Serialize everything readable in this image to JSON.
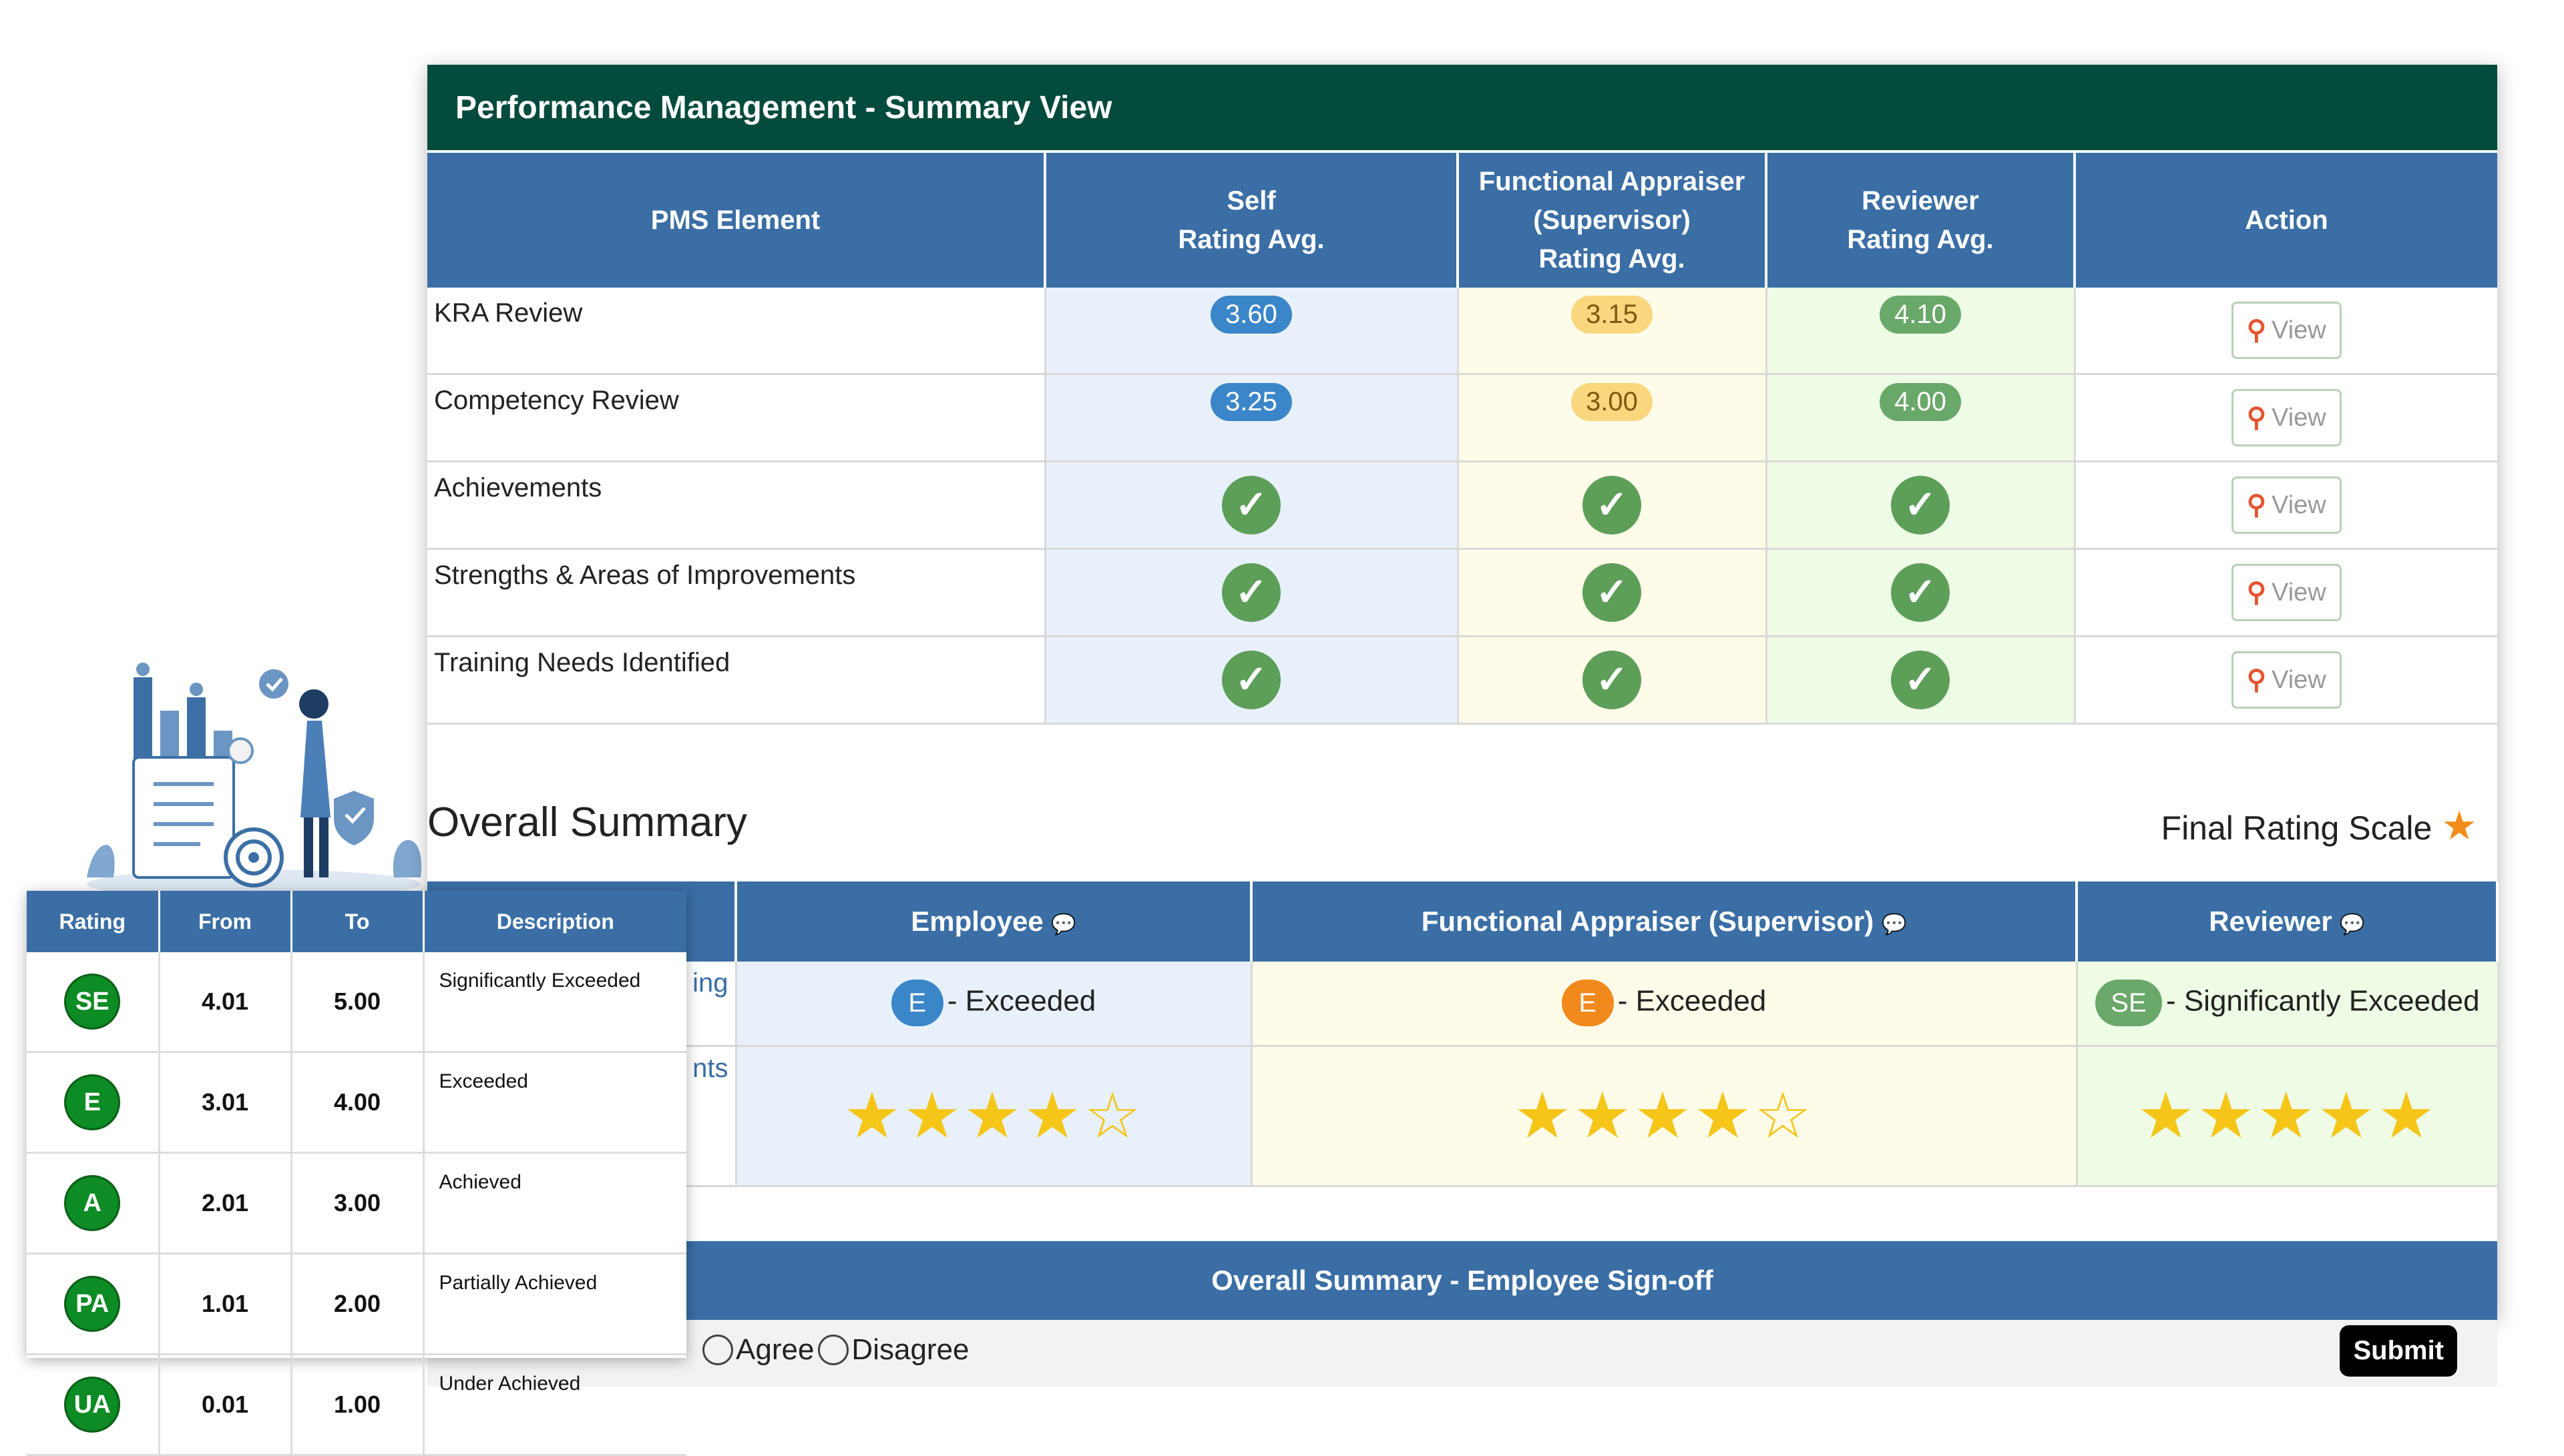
{
  "header": {
    "title": "Performance Management - Summary View"
  },
  "pms_table": {
    "columns": [
      "PMS Element",
      "Self\nRating Avg.",
      "Functional Appraiser\n(Supervisor)\nRating Avg.",
      "Reviewer\nRating Avg.",
      "Action"
    ],
    "rows": [
      {
        "name": "KRA Review",
        "self": "3.60",
        "functional": "3.15",
        "reviewer": "4.10",
        "action": "View"
      },
      {
        "name": "Competency Review",
        "self": "3.25",
        "functional": "3.00",
        "reviewer": "4.00",
        "action": "View"
      },
      {
        "name": "Achievements",
        "self": "check",
        "functional": "check",
        "reviewer": "check",
        "action": "View"
      },
      {
        "name": "Strengths & Areas of Improvements",
        "self": "check",
        "functional": "check",
        "reviewer": "check",
        "action": "View"
      },
      {
        "name": "Training Needs Identified",
        "self": "check",
        "functional": "check",
        "reviewer": "check",
        "action": "View"
      }
    ]
  },
  "overall": {
    "title": "Overall Summary",
    "scale_link": "Final Rating Scale",
    "columns": [
      "",
      "Employee",
      "Functional Appraiser (Supervisor)",
      "Reviewer"
    ],
    "row_labels": [
      "ing",
      "nts"
    ],
    "grades": [
      {
        "code": "E",
        "text": "- Exceeded",
        "color": "#3b86c9"
      },
      {
        "code": "E",
        "text": "- Exceeded",
        "color": "#f2891c"
      },
      {
        "code": "SE",
        "text": "- Significantly Exceeded",
        "color": "#6aa86a"
      }
    ],
    "star_ratings": [
      4,
      4,
      5
    ],
    "star_max": 5
  },
  "signoff": {
    "title": "Overall Summary - Employee Sign-off",
    "agree": "Agree",
    "disagree": "Disagree",
    "submit": "Submit"
  },
  "legend": {
    "columns": [
      "Rating",
      "From",
      "To",
      "Description"
    ],
    "rows": [
      {
        "code": "SE",
        "from": "4.01",
        "to": "5.00",
        "desc": "Significantly Exceeded"
      },
      {
        "code": "E",
        "from": "3.01",
        "to": "4.00",
        "desc": "Exceeded"
      },
      {
        "code": "A",
        "from": "2.01",
        "to": "3.00",
        "desc": "Achieved"
      },
      {
        "code": "PA",
        "from": "1.01",
        "to": "2.00",
        "desc": "Partially Achieved"
      },
      {
        "code": "UA",
        "from": "0.01",
        "to": "1.00",
        "desc": "Under Achieved"
      }
    ]
  },
  "icons": {
    "view": "search-icon",
    "check": "check-circle-icon",
    "comment": "comment-icon",
    "scale": "star-icon"
  }
}
